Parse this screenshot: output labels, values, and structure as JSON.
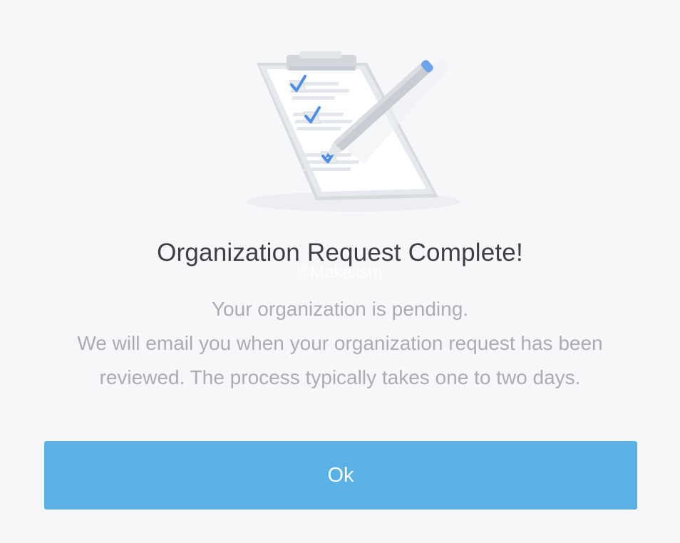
{
  "dialog": {
    "illustration_icon": "clipboard-checklist-with-pencil-icon",
    "title": "Organization Request Complete!",
    "watermark": "©Makeiism",
    "message_lines": [
      "Your organization is pending.",
      "We will email you when your organization request has been",
      "reviewed. The process typically takes one to two days."
    ],
    "ok_label": "Ok"
  },
  "colors": {
    "background": "#f7f7f9",
    "title_text": "#3c4043",
    "body_text": "#a9adb3",
    "button_bg": "#5ab1e6",
    "button_text": "#ffffff",
    "check_accent": "#4c8ee8"
  }
}
